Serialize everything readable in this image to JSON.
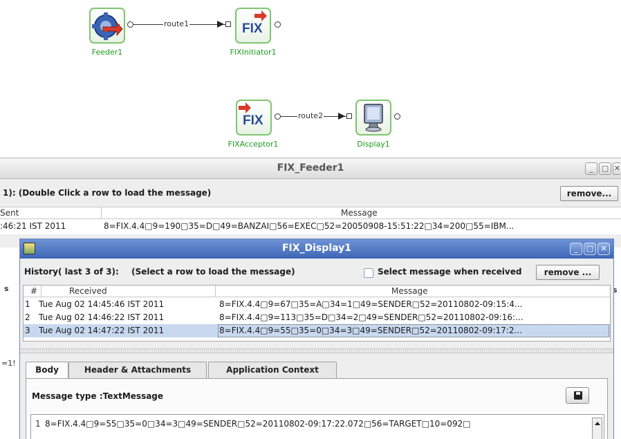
{
  "canvas": {
    "nodes": [
      {
        "label": "Feeder1"
      },
      {
        "label": "FIXInitiator1",
        "icon_text": "FIX"
      },
      {
        "label": "FIXAcceptor1",
        "icon_text": "FIX"
      },
      {
        "label": "Display1"
      }
    ],
    "routes": [
      {
        "label": "route1"
      },
      {
        "label": "route2"
      }
    ]
  },
  "feeder_window": {
    "title": "FIX_Feeder1",
    "history_text": "1):   (Double Click a row to load the message)",
    "remove_label": "remove...",
    "columns": [
      "Sent",
      "Message"
    ],
    "row": {
      "sent": ":46:21 IST 2011",
      "message": "8=FIX.4.4□9=190□35=D□49=BANZAI□56=EXEC□52=20050908-15:51:22□34=200□55=IBM..."
    }
  },
  "display_window": {
    "title": "FIX_Display1",
    "history_label": "History( last 3 of 3):",
    "instruction": "(Select a row to load the message)",
    "checkbox_label": "Select message when received",
    "checkbox_checked": false,
    "remove_label": "remove ...",
    "columns": [
      "#",
      "Received",
      "Message"
    ],
    "rows": [
      {
        "n": "1",
        "received": "Tue Aug 02 14:45:46 IST 2011",
        "message": "8=FIX.4.4□9=67□35=A□34=1□49=SENDER□52=20110802-09:15:4..."
      },
      {
        "n": "2",
        "received": "Tue Aug 02 14:46:22 IST 2011",
        "message": "8=FIX.4.4□9=113□35=D□34=2□49=SENDER□52=20110802-09:16:..."
      },
      {
        "n": "3",
        "received": "Tue Aug 02 14:47:22 IST 2011",
        "message": "8=FIX.4.4□9=55□35=0□34=3□49=SENDER□52=20110802-09:17:2...",
        "selected": true
      }
    ],
    "tabs": [
      "Body",
      "Header & Attachments",
      "Application Context"
    ],
    "active_tab": "Body",
    "message_type_label": "Message type :TextMessage",
    "editor": {
      "line_number": "1",
      "content": "8=FIX.4.4□9=55□35=0□34=3□49=SENDER□52=20110802-09:17:22.072□56=TARGET□10=092□"
    }
  },
  "background_fragments": [
    "s",
    "s",
    "=1!"
  ],
  "colors": {
    "node_border": "#7fc46f",
    "node_label": "#1f9b1f",
    "title_active": "#3d66b5",
    "selection": "#c8d8ef"
  }
}
